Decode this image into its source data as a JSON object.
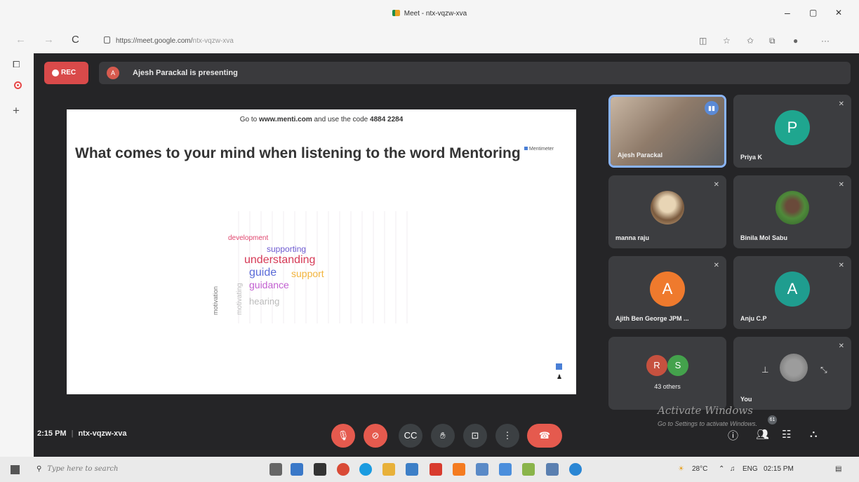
{
  "browser": {
    "tab_title": "Meet - ntx-vqzw-xva",
    "url_host": "https://meet.google.com/",
    "url_path": "ntx-vqzw-xva",
    "win_min": "–",
    "win_max": "▫",
    "win_close": "✕",
    "reload": "C"
  },
  "meet": {
    "rec_label": "REC",
    "presenter_initial": "A",
    "presenting_text": "Ajesh Parackal is presenting",
    "time": "2:15 PM",
    "meeting_code": "ntx-vqzw-xva",
    "chat_badge": "61"
  },
  "slide": {
    "code_prefix": "Go to",
    "code_site": "www.menti.com",
    "code_middle": "and use the code",
    "code_number": "4884 2284",
    "question": "What comes to your mind when listening to the word Mentoring",
    "brand": "Mentimeter",
    "words": [
      {
        "text": "understanding",
        "color": "#d63a56"
      },
      {
        "text": "guide",
        "color": "#5a6bd8"
      },
      {
        "text": "support",
        "color": "#f2b43d"
      },
      {
        "text": "guidance",
        "color": "#c25fd0"
      },
      {
        "text": "development",
        "color": "#e0466e"
      },
      {
        "text": "supporting",
        "color": "#6e5bd1"
      },
      {
        "text": "motivation",
        "color": "#7a7a7a"
      },
      {
        "text": "hearing",
        "color": "#bbbbbb"
      },
      {
        "text": "motivating",
        "color": "#bdbdbd"
      }
    ]
  },
  "participants": [
    {
      "name": "Ajesh Parackal",
      "type": "video"
    },
    {
      "name": "Priya K",
      "initial": "P",
      "color": "#1fa68f"
    },
    {
      "name": "manna raju",
      "type": "photo"
    },
    {
      "name": "Binila Mol Sabu",
      "type": "photo"
    },
    {
      "name": "Ajith Ben George JPM ...",
      "initial": "A",
      "color": "#ef7a2d"
    },
    {
      "name": "Anju C.P",
      "initial": "A",
      "color": "#1f9d8f"
    },
    {
      "others_label": "43 others",
      "av1": "R",
      "av1_color": "#c6513f",
      "av2": "S",
      "av2_color": "#44a24c"
    },
    {
      "name": "You"
    }
  ],
  "windows_notice": {
    "title": "Activate Windows",
    "subtitle": "Go to Settings to activate Windows."
  },
  "taskbar": {
    "search_placeholder": "Type here to search",
    "temperature": "28°C",
    "language": "ENG",
    "clock": "02:15 PM"
  }
}
